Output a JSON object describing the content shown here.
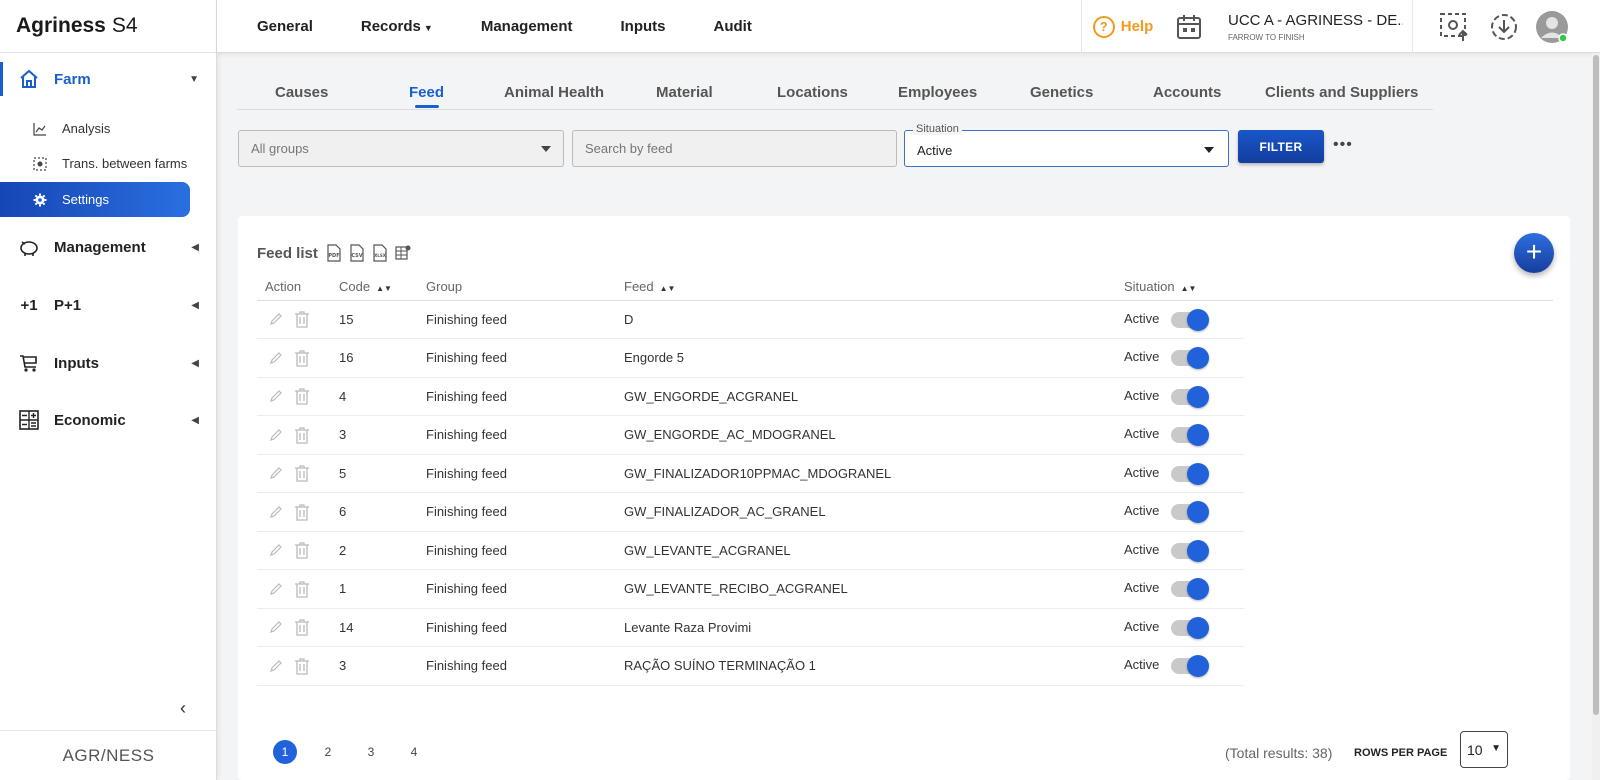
{
  "app": {
    "brand_bold": "Agriness",
    "brand_rest": "S4",
    "footer_logo": "AGR/NESS"
  },
  "sidebar": {
    "farm": "Farm",
    "sub": [
      {
        "label": "Analysis"
      },
      {
        "label": "Trans. between farms"
      },
      {
        "label": "Settings"
      }
    ],
    "management": "Management",
    "p1": "P+1",
    "p1_icon": "+1",
    "inputs": "Inputs",
    "economic": "Economic"
  },
  "topmenu": {
    "general": "General",
    "records": "Records",
    "management": "Management",
    "inputs": "Inputs",
    "audit": "Audit"
  },
  "header": {
    "help": "Help",
    "farm_name": "UCC A - AGRINESS - DE...",
    "farm_type": "FARROW TO FINISH"
  },
  "tabs": [
    "Causes",
    "Feed",
    "Animal Health",
    "Material",
    "Locations",
    "Employees",
    "Genetics",
    "Accounts",
    "Clients and Suppliers"
  ],
  "filters": {
    "group_value": "All groups",
    "search_placeholder": "Search by feed",
    "situation_label": "Situation",
    "situation_value": "Active",
    "filter_button": "FILTER",
    "more": "•••"
  },
  "list": {
    "title": "Feed list",
    "export": [
      "PDF",
      "CSV",
      "XLSX"
    ],
    "add": "+",
    "columns": {
      "action": "Action",
      "code": "Code",
      "group": "Group",
      "feed": "Feed",
      "situation": "Situation"
    },
    "rows": [
      {
        "code": "15",
        "group": "Finishing feed",
        "feed": "D",
        "situation": "Active"
      },
      {
        "code": "16",
        "group": "Finishing feed",
        "feed": "Engorde 5",
        "situation": "Active"
      },
      {
        "code": "4",
        "group": "Finishing feed",
        "feed": "GW_ENGORDE_ACGRANEL",
        "situation": "Active"
      },
      {
        "code": "3",
        "group": "Finishing feed",
        "feed": "GW_ENGORDE_AC_MDOGRANEL",
        "situation": "Active"
      },
      {
        "code": "5",
        "group": "Finishing feed",
        "feed": "GW_FINALIZADOR10PPMAC_MDOGRANEL",
        "situation": "Active"
      },
      {
        "code": "6",
        "group": "Finishing feed",
        "feed": "GW_FINALIZADOR_AC_GRANEL",
        "situation": "Active"
      },
      {
        "code": "2",
        "group": "Finishing feed",
        "feed": "GW_LEVANTE_ACGRANEL",
        "situation": "Active"
      },
      {
        "code": "1",
        "group": "Finishing feed",
        "feed": "GW_LEVANTE_RECIBO_ACGRANEL",
        "situation": "Active"
      },
      {
        "code": "14",
        "group": "Finishing feed",
        "feed": "Levante Raza Provimi",
        "situation": "Active"
      },
      {
        "code": "3",
        "group": "Finishing feed",
        "feed": "RAÇÃO SUÍNO TERMINAÇÃO 1",
        "situation": "Active"
      }
    ]
  },
  "pagination": {
    "pages": [
      "1",
      "2",
      "3",
      "4"
    ],
    "total": "(Total results: 38)",
    "rows_per_page_label": "ROWS PER PAGE",
    "rows_per_page": "10"
  },
  "colors": {
    "accent": "#1a5fd0",
    "help": "#f39a1e"
  }
}
